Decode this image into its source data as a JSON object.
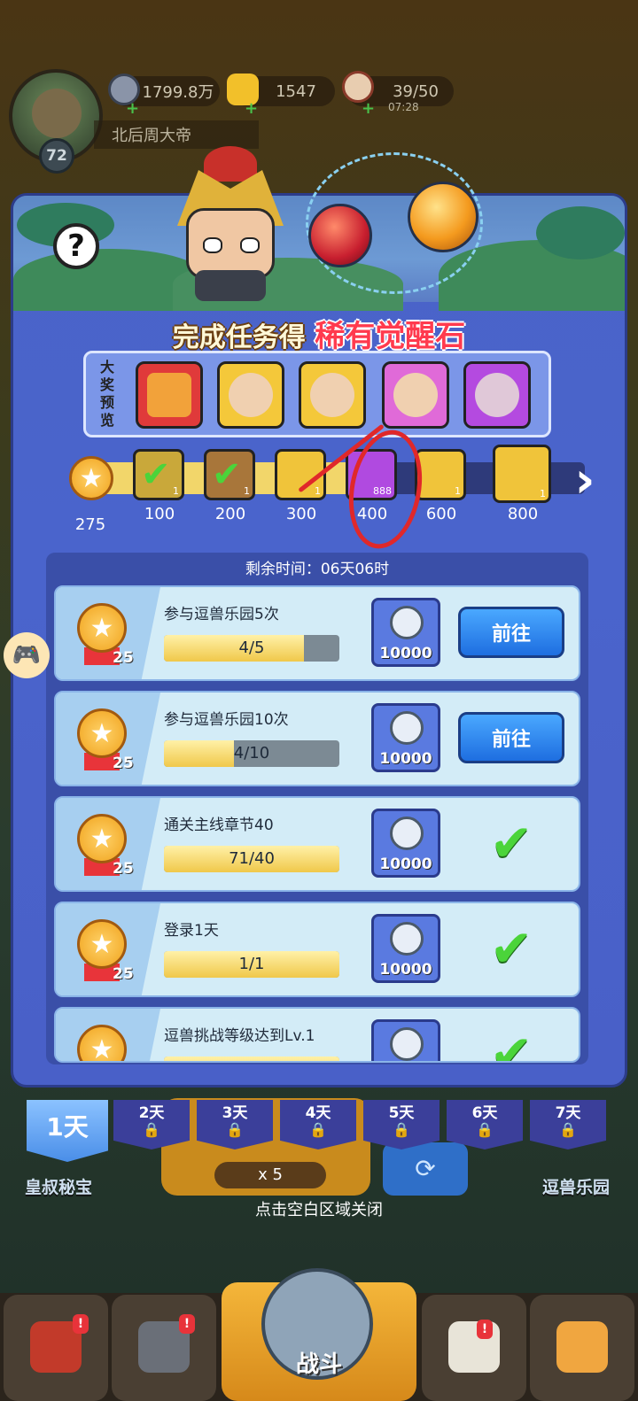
{
  "hud": {
    "level": "72",
    "player_name": "北后周大帝",
    "silver": "1799.8万",
    "gold": "1547",
    "stamina": "39/50",
    "stamina_timer": "07:28"
  },
  "panel": {
    "title_prefix": "完成任务得",
    "title_highlight": "稀有觉醒石",
    "preview_label": "大奖预览",
    "current_score": "275",
    "milestones": [
      {
        "value": "100",
        "count": "1",
        "claimed": true
      },
      {
        "value": "200",
        "count": "1",
        "claimed": true
      },
      {
        "value": "300",
        "count": "1",
        "claimed": false
      },
      {
        "value": "400",
        "count": "888",
        "claimed": false
      },
      {
        "value": "600",
        "count": "1",
        "claimed": false
      },
      {
        "value": "800",
        "count": "1",
        "claimed": false
      }
    ],
    "remaining_label": "剩余时间：06天06时"
  },
  "tasks": [
    {
      "name": "参与逗兽乐园5次",
      "progress": "4/5",
      "ratio": 0.8,
      "points": "25",
      "reward": "10000",
      "action": "前往"
    },
    {
      "name": "参与逗兽乐园10次",
      "progress": "4/10",
      "ratio": 0.4,
      "points": "25",
      "reward": "10000",
      "action": "前往"
    },
    {
      "name": "通关主线章节40",
      "progress": "71/40",
      "ratio": 1.0,
      "points": "25",
      "reward": "10000",
      "action": ""
    },
    {
      "name": "登录1天",
      "progress": "1/1",
      "ratio": 1.0,
      "points": "25",
      "reward": "10000",
      "action": ""
    },
    {
      "name": "逗兽挑战等级达到Lv.1",
      "progress": "",
      "ratio": 1.0,
      "points": "25",
      "reward": "",
      "action": ""
    }
  ],
  "day_tabs": [
    "1天",
    "2天",
    "3天",
    "4天",
    "5天",
    "6天",
    "7天"
  ],
  "background": {
    "left_label": "皇叔秘宝",
    "right_label": "逗兽乐园",
    "cost": "x 5",
    "close_hint": "点击空白区域关闭",
    "battle_label": "战斗"
  },
  "colors": {
    "panel": "#4a63c8",
    "accent_red": "#ff3a4e",
    "check_green": "#4bd43a",
    "go_button": "#1e6ee0"
  }
}
